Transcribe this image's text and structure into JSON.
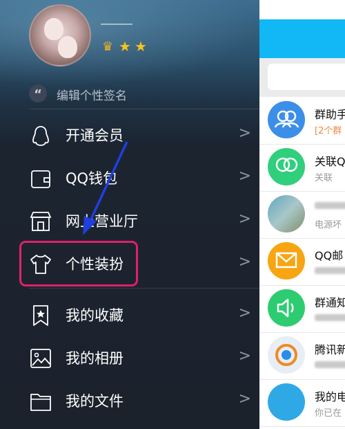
{
  "profile": {
    "signature_placeholder": "编辑个性签名",
    "signature_icon_glyph": "“"
  },
  "menu": [
    {
      "id": "vip",
      "label": "开通会员",
      "icon": "penguin-icon"
    },
    {
      "id": "wallet",
      "label": "QQ钱包",
      "icon": "wallet-icon"
    },
    {
      "id": "hall",
      "label": "网上营业厅",
      "icon": "store-icon"
    },
    {
      "id": "dressup",
      "label": "个性装扮",
      "icon": "tshirt-icon"
    },
    {
      "id": "favorites",
      "label": "我的收藏",
      "icon": "bookmark-star-icon"
    },
    {
      "id": "album",
      "label": "我的相册",
      "icon": "photo-icon"
    },
    {
      "id": "files",
      "label": "我的文件",
      "icon": "folder-icon"
    }
  ],
  "chats": [
    {
      "name": "群助手",
      "sub": "[2个群",
      "sub_color": "#f0883c",
      "avatar_color": "#3b8fe8"
    },
    {
      "name": "关联Q",
      "sub": "关联",
      "sub_color": "#999999",
      "avatar_color": "#2fcf7c"
    },
    {
      "name": "",
      "sub": "电源坏",
      "sub_color": "#999999",
      "avatar_color": "#7aa7b4"
    },
    {
      "name": "QQ邮",
      "sub": "",
      "sub_color": "#999999",
      "avatar_color": "#f7a512"
    },
    {
      "name": "群通知",
      "sub": "",
      "sub_color": "#999999",
      "avatar_color": "#2ecc71"
    },
    {
      "name": "腾讯新",
      "sub": "",
      "sub_color": "#999999",
      "avatar_color": "#e8eef5"
    },
    {
      "name": "我的电",
      "sub": "你已在",
      "sub_color": "#999999",
      "avatar_color": "#2fa8e6"
    }
  ],
  "colors": {
    "accent": "#12b7f5",
    "highlight": "#e0206a",
    "arrow": "#1f3fe0"
  }
}
